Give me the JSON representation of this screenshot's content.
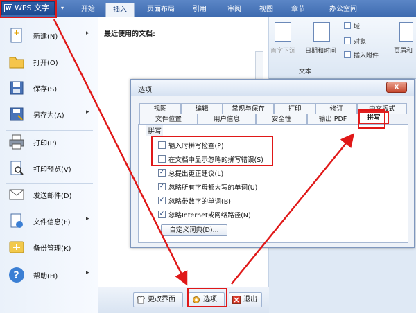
{
  "app": {
    "title": "WPS 文字",
    "logo_glyph": "W"
  },
  "tabs": [
    "开始",
    "插入",
    "页面布局",
    "引用",
    "审阅",
    "视图",
    "章节",
    "办公空间"
  ],
  "ribbon": {
    "items": [
      "首字下沉",
      "日期和时间",
      "域",
      "对象",
      "插入附件",
      "页眉和"
    ],
    "group_label": "文本"
  },
  "menu": {
    "items": [
      {
        "label": "新建(N)",
        "icon": "new-document-icon",
        "has_sub": true
      },
      {
        "label": "打开(O)",
        "icon": "open-folder-icon",
        "has_sub": false
      },
      {
        "label": "保存(S)",
        "icon": "save-disk-icon",
        "has_sub": false
      },
      {
        "label": "另存为(A)",
        "icon": "save-as-icon",
        "has_sub": true
      },
      {
        "label": "打印(P)",
        "icon": "printer-icon",
        "has_sub": false
      },
      {
        "label": "打印预览(V)",
        "icon": "print-preview-icon",
        "has_sub": false
      },
      {
        "label": "发送邮件(D)",
        "icon": "mail-icon",
        "has_sub": false
      },
      {
        "label": "文件信息(F)",
        "icon": "file-info-icon",
        "has_sub": true
      },
      {
        "label": "备份管理(K)",
        "icon": "backup-icon",
        "has_sub": false
      },
      {
        "label": "帮助(H)",
        "icon": "help-icon",
        "has_sub": true
      }
    ],
    "submenu_glyph": "▸"
  },
  "recent": {
    "title": "最近使用的文档:"
  },
  "bottom": {
    "change_ui": "更改界面",
    "options": "选项",
    "exit": "退出"
  },
  "dialog": {
    "title": "选项",
    "close_glyph": "x",
    "tabs_row1": [
      "视图",
      "编辑",
      "常规与保存",
      "打印",
      "修订",
      "中文版式"
    ],
    "tabs_row2": [
      "文件位置",
      "用户信息",
      "安全性",
      "输出 PDF",
      "拼写"
    ],
    "section": "拼写",
    "options": [
      {
        "label": "输入时拼写检查(P)",
        "checked": false
      },
      {
        "label": "在文档中显示忽略的拼写错误(S)",
        "checked": false
      },
      {
        "label": "总提出更正建议(L)",
        "checked": true
      },
      {
        "label": "忽略所有字母都大写的单词(U)",
        "checked": true
      },
      {
        "label": "忽略带数字的单词(B)",
        "checked": true
      },
      {
        "label": "忽略Internet或网络路径(N)",
        "checked": true
      }
    ],
    "custom_dict": "自定义词典(D)..."
  },
  "colors": {
    "highlight": "#e01818",
    "title_blue": "#3e6bb0"
  }
}
